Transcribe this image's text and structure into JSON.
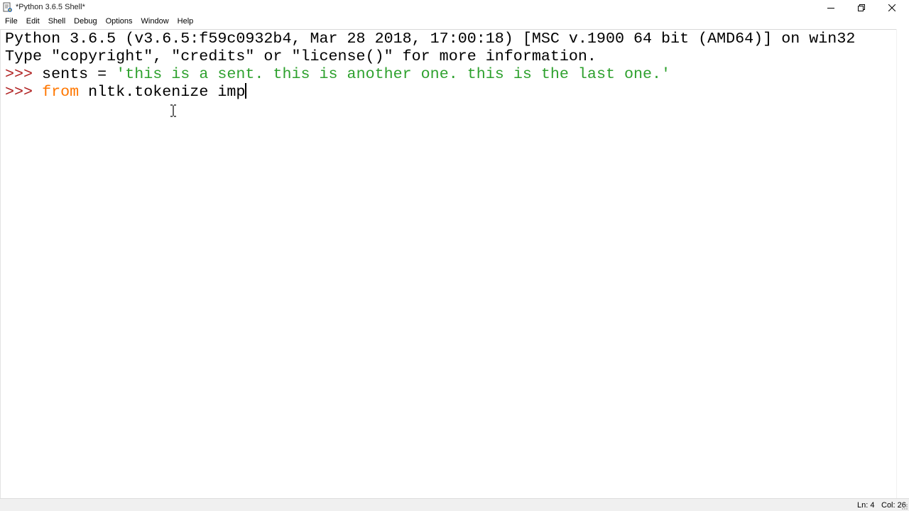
{
  "window": {
    "title": "*Python 3.6.5 Shell*",
    "icon": "python-idle-icon",
    "controls": [
      "minimize-icon",
      "restore-icon",
      "close-icon"
    ]
  },
  "menu": {
    "items": [
      "File",
      "Edit",
      "Shell",
      "Debug",
      "Options",
      "Window",
      "Help"
    ]
  },
  "shell": {
    "banner_line1": "Python 3.6.5 (v3.6.5:f59c0932b4, Mar 28 2018, 17:00:18) [MSC v.1900 64 bit (AMD64)] on win32",
    "banner_line2": "Type \"copyright\", \"credits\" or \"license()\" for more information.",
    "prompt": ">>>",
    "line3": {
      "code": " sents = ",
      "string": "'this is a sent. this is another one. this is the last one.'"
    },
    "line4": {
      "keyword": "from",
      "code": " nltk.tokenize imp"
    }
  },
  "status": {
    "line": "Ln: 4",
    "col": "Col: 26"
  },
  "colors": {
    "prompt": "#b02020",
    "string": "#2ea12e",
    "keyword": "#ff7700",
    "text": "#000000"
  }
}
